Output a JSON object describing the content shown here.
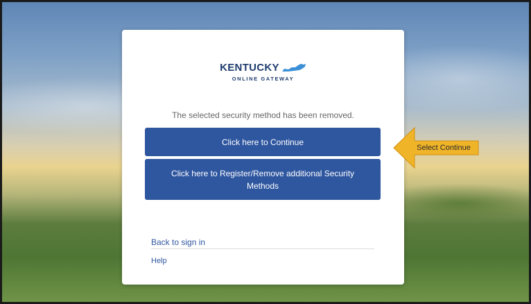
{
  "logo": {
    "title": "KENTUCKY",
    "subtitle": "ONLINE GATEWAY"
  },
  "message": "The selected security method has been removed.",
  "buttons": {
    "continue": "Click here to Continue",
    "register": "Click here to Register/Remove additional Security Methods"
  },
  "links": {
    "back": "Back to sign in",
    "help": "Help"
  },
  "annotation": {
    "label": "Select Continue",
    "color": "#f0b429"
  },
  "colors": {
    "primary": "#2f57a0",
    "logo": "#1f3c6e"
  }
}
